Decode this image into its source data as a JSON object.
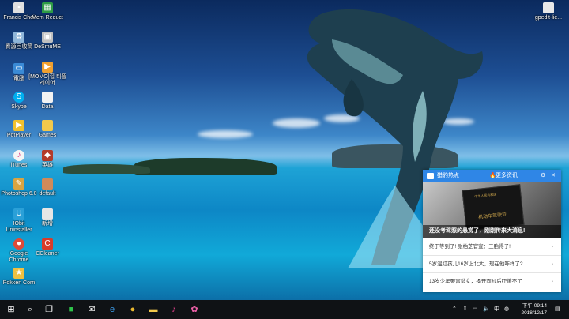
{
  "desktop": {
    "icons": [
      {
        "label": "Francis Choi",
        "icon": "folder-user-icon",
        "color": "#e8e8e8"
      },
      {
        "label": "Mem Reduct",
        "icon": "memreduct-icon",
        "color": "#2e9c46"
      },
      {
        "label": "資源回收筒",
        "icon": "recycle-bin-icon",
        "color": "#8fb6d9"
      },
      {
        "label": "DeSmuME",
        "icon": "desmume-icon",
        "color": "#c0c0c0"
      },
      {
        "label": "電腦",
        "icon": "computer-icon",
        "color": "#3a8ad6"
      },
      {
        "label": "[MOMO]힐 티플레이어",
        "icon": "player-icon",
        "color": "#f0a030"
      },
      {
        "label": "Skype",
        "icon": "skype-icon",
        "color": "#00aff0"
      },
      {
        "label": "Data",
        "icon": "file-icon",
        "color": "#f2f2f2"
      },
      {
        "label": "PotPlayer",
        "icon": "potplayer-icon",
        "color": "#f2c12e"
      },
      {
        "label": "Games",
        "icon": "folder-icon",
        "color": "#f2c94c"
      },
      {
        "label": "iTunes",
        "icon": "itunes-icon",
        "color": "#f5f5f5"
      },
      {
        "label": "英雄",
        "icon": "game-icon",
        "color": "#b33a2a"
      },
      {
        "label": "Photoshop 6.0",
        "icon": "photoshop-icon",
        "color": "#d9a441"
      },
      {
        "label": "default",
        "icon": "file-icon",
        "color": "#d08a5a"
      },
      {
        "label": "IObit Uninstaller",
        "icon": "uninstaller-icon",
        "color": "#2aa0d8"
      },
      {
        "label": "新增",
        "icon": "file-icon",
        "color": "#e6e6e6"
      },
      {
        "label": "Google Chrome",
        "icon": "chrome-icon",
        "color": "#dd4b39"
      },
      {
        "label": "CCleaner",
        "icon": "ccleaner-icon",
        "color": "#d83b2a"
      },
      {
        "label": "Pokkén Corn",
        "icon": "pokken-icon",
        "color": "#f0c040"
      }
    ],
    "right_icon": {
      "label": "gpedit-lie...",
      "icon": "shortcut-icon",
      "color": "#e8e8e8"
    }
  },
  "popup": {
    "title": "猎豹热点",
    "more": "更多资讯",
    "image_card_top": "中华人民共和国",
    "image_card_text": "机动车驾驶证",
    "headline": "还没考驾照的悬赏了，刚刚传来大消息!",
    "items": [
      "终于等到了! 张柏芝官宣：三胎得子!",
      "5岁温红孩儿16岁上北大，现在他咋样了?",
      "13岁少年娶富翁女，揭开面纱后吓傻不了"
    ]
  },
  "taskbar": {
    "time": "下午 09:14",
    "date": "2018/12/17",
    "ime": "中"
  }
}
